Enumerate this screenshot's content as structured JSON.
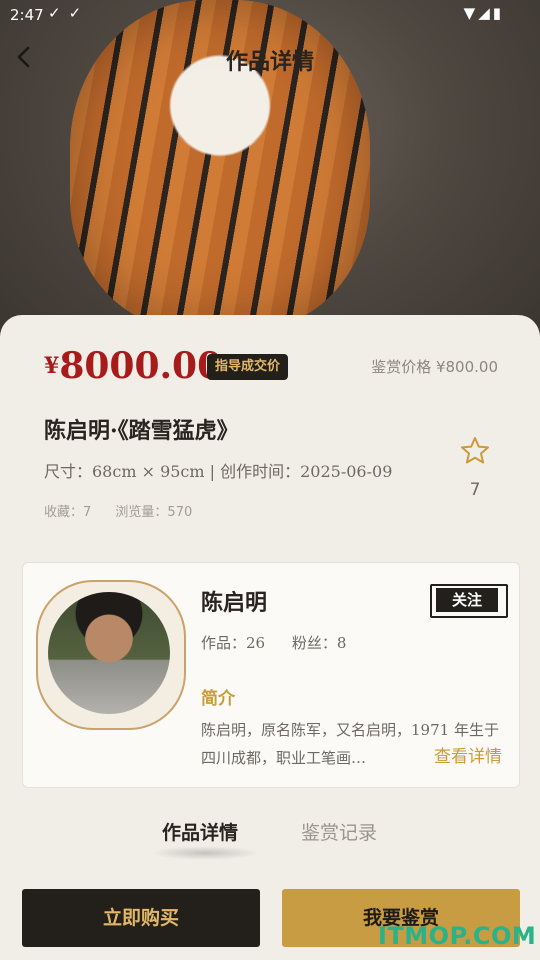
{
  "status_bar": {
    "time": "2:47",
    "left_icons": [
      "download-done-icon",
      "download-done-icon"
    ],
    "right_icons": [
      "wifi-icon",
      "signal-icon",
      "battery-icon"
    ]
  },
  "header": {
    "title": "作品详情"
  },
  "artwork": {
    "price_symbol": "¥",
    "price_value": "8000.00",
    "price_badge": "指导成交价",
    "appraise_price": "鉴赏价格 ¥800.00",
    "title": "陈启明·《踏雪猛虎》",
    "meta": "尺寸：68cm × 95cm | 创作时间：2025-06-09",
    "collect_count": "收藏：7",
    "view_count": "浏览量：570",
    "favorite_count": "7"
  },
  "artist": {
    "name": "陈启明",
    "follow_label": "关注",
    "works": "作品：26",
    "fans": "粉丝：8",
    "intro_heading": "简介",
    "intro_text": "陈启明，原名陈军，又名启明，1971 年生于四川成都，职业工笔画…",
    "more_label": "查看详情"
  },
  "tabs": [
    {
      "label": "作品详情",
      "active": true
    },
    {
      "label": "鉴赏记录",
      "active": false
    }
  ],
  "actions": {
    "buy_label": "立即购买",
    "appraise_label": "我要鉴赏"
  },
  "watermark": "ITMOP.COM",
  "colors": {
    "price_red": "#a81b1b",
    "gold": "#c79c42",
    "dark": "#23201c"
  }
}
